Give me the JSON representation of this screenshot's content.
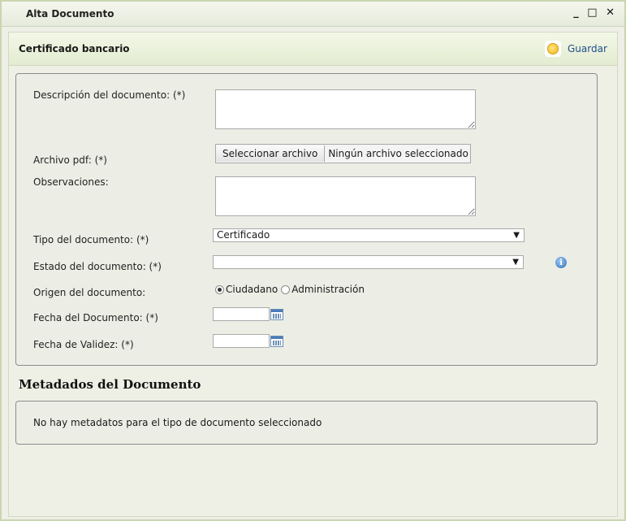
{
  "window": {
    "title": "Alta Documento",
    "controls": {
      "minimize": "_",
      "maximize": "□",
      "close": "✕"
    }
  },
  "toolbar": {
    "section_title": "Certificado bancario",
    "save_label": "Guardar",
    "save_icon": "save-disc-icon"
  },
  "form": {
    "descripcion": {
      "label": "Descripción del documento: (*)",
      "value": ""
    },
    "archivo": {
      "label": "Archivo pdf: (*)",
      "button": "Seleccionar archivo",
      "status": "Ningún archivo seleccionado"
    },
    "observaciones": {
      "label": "Observaciones:",
      "value": ""
    },
    "tipo": {
      "label": "Tipo del documento: (*)",
      "selected": "Certificado"
    },
    "estado": {
      "label": "Estado del documento: (*)",
      "selected": "",
      "info_icon": "info-icon"
    },
    "origen": {
      "label": "Origen del documento:",
      "options": [
        "Ciudadano",
        "Administración"
      ],
      "selected": "Ciudadano"
    },
    "fecha_documento": {
      "label": "Fecha del Documento: (*)",
      "value": ""
    },
    "fecha_validez": {
      "label": "Fecha de Validez: (*)",
      "value": ""
    }
  },
  "metadatos": {
    "title": "Metadados del Documento",
    "message": "No hay metadatos para el tipo de documento seleccionado"
  },
  "colors": {
    "accent_text": "#1f4e8c",
    "toolbar_bg": "#e3ecd0",
    "window_bg": "#eeefe6"
  }
}
